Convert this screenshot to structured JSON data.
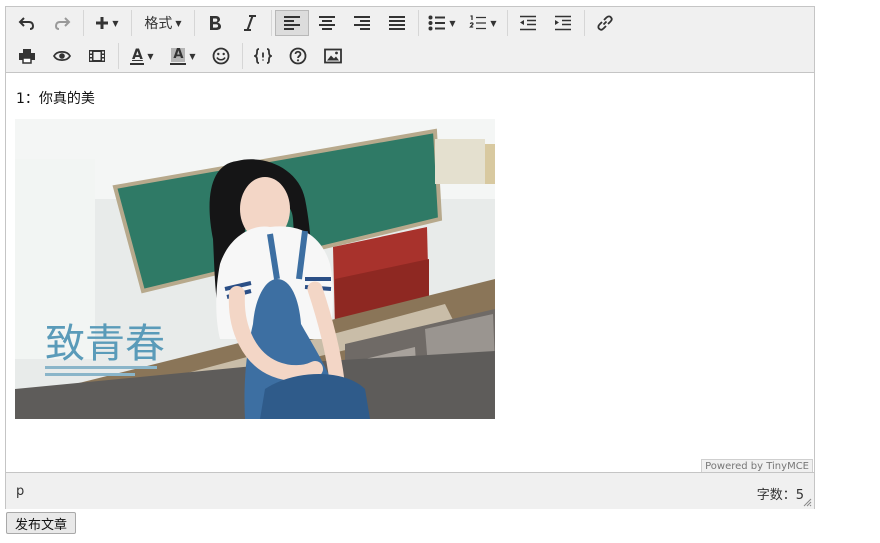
{
  "toolbar": {
    "format_label": "格式",
    "text_color_letter": "A",
    "bg_color_letter": "A"
  },
  "content": {
    "paragraph": "1：你真的美",
    "image_overlay_title": "致青春"
  },
  "branding": "Powered by TinyMCE",
  "status": {
    "path": "p",
    "word_count": "字数：5"
  },
  "publish_button": "发布文章",
  "colors": {
    "toolbar_bg": "#f0f0f0",
    "border": "#c5c5c5",
    "active_btn": "#dcdcdc"
  }
}
